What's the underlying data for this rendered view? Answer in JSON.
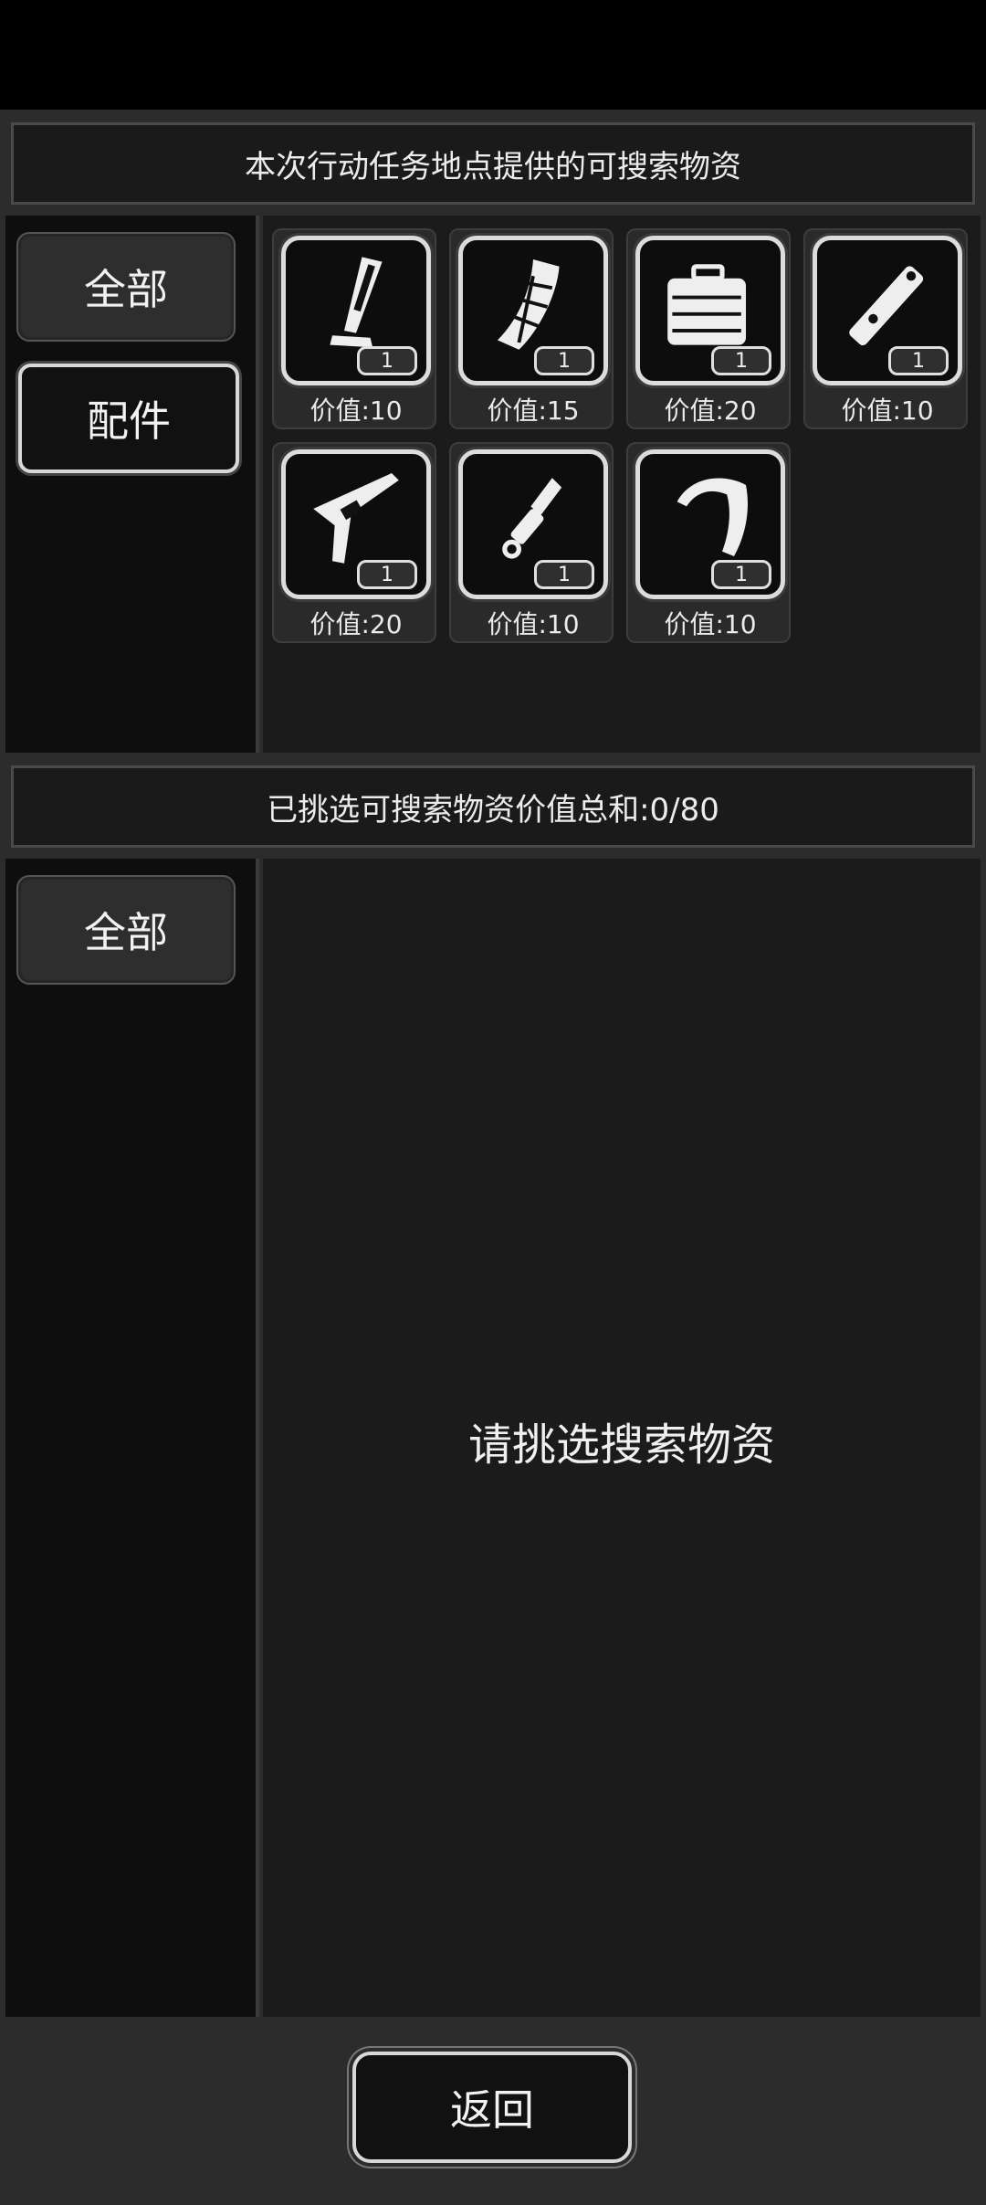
{
  "top_panel": {
    "header": "本次行动任务地点提供的可搜索物资",
    "tabs": [
      {
        "label": "全部",
        "active": false
      },
      {
        "label": "配件",
        "active": true
      }
    ],
    "items": [
      {
        "icon": "magazine-icon",
        "count": "1",
        "price": "价值:10"
      },
      {
        "icon": "drum-magazine-icon",
        "count": "1",
        "price": "价值:15"
      },
      {
        "icon": "toolbox-icon",
        "count": "1",
        "price": "价值:20"
      },
      {
        "icon": "suppressor-icon",
        "count": "1",
        "price": "价值:10"
      },
      {
        "icon": "stock-icon",
        "count": "1",
        "price": "价值:20"
      },
      {
        "icon": "muzzle-brake-icon",
        "count": "1",
        "price": "价值:10"
      },
      {
        "icon": "curved-magazine-icon",
        "count": "1",
        "price": "价值:10"
      }
    ]
  },
  "bottom_panel": {
    "header": "已挑选可搜索物资价值总和:0/80",
    "tabs": [
      {
        "label": "全部"
      }
    ],
    "empty_message": "请挑选搜索物资"
  },
  "footer": {
    "back_label": "返回"
  }
}
